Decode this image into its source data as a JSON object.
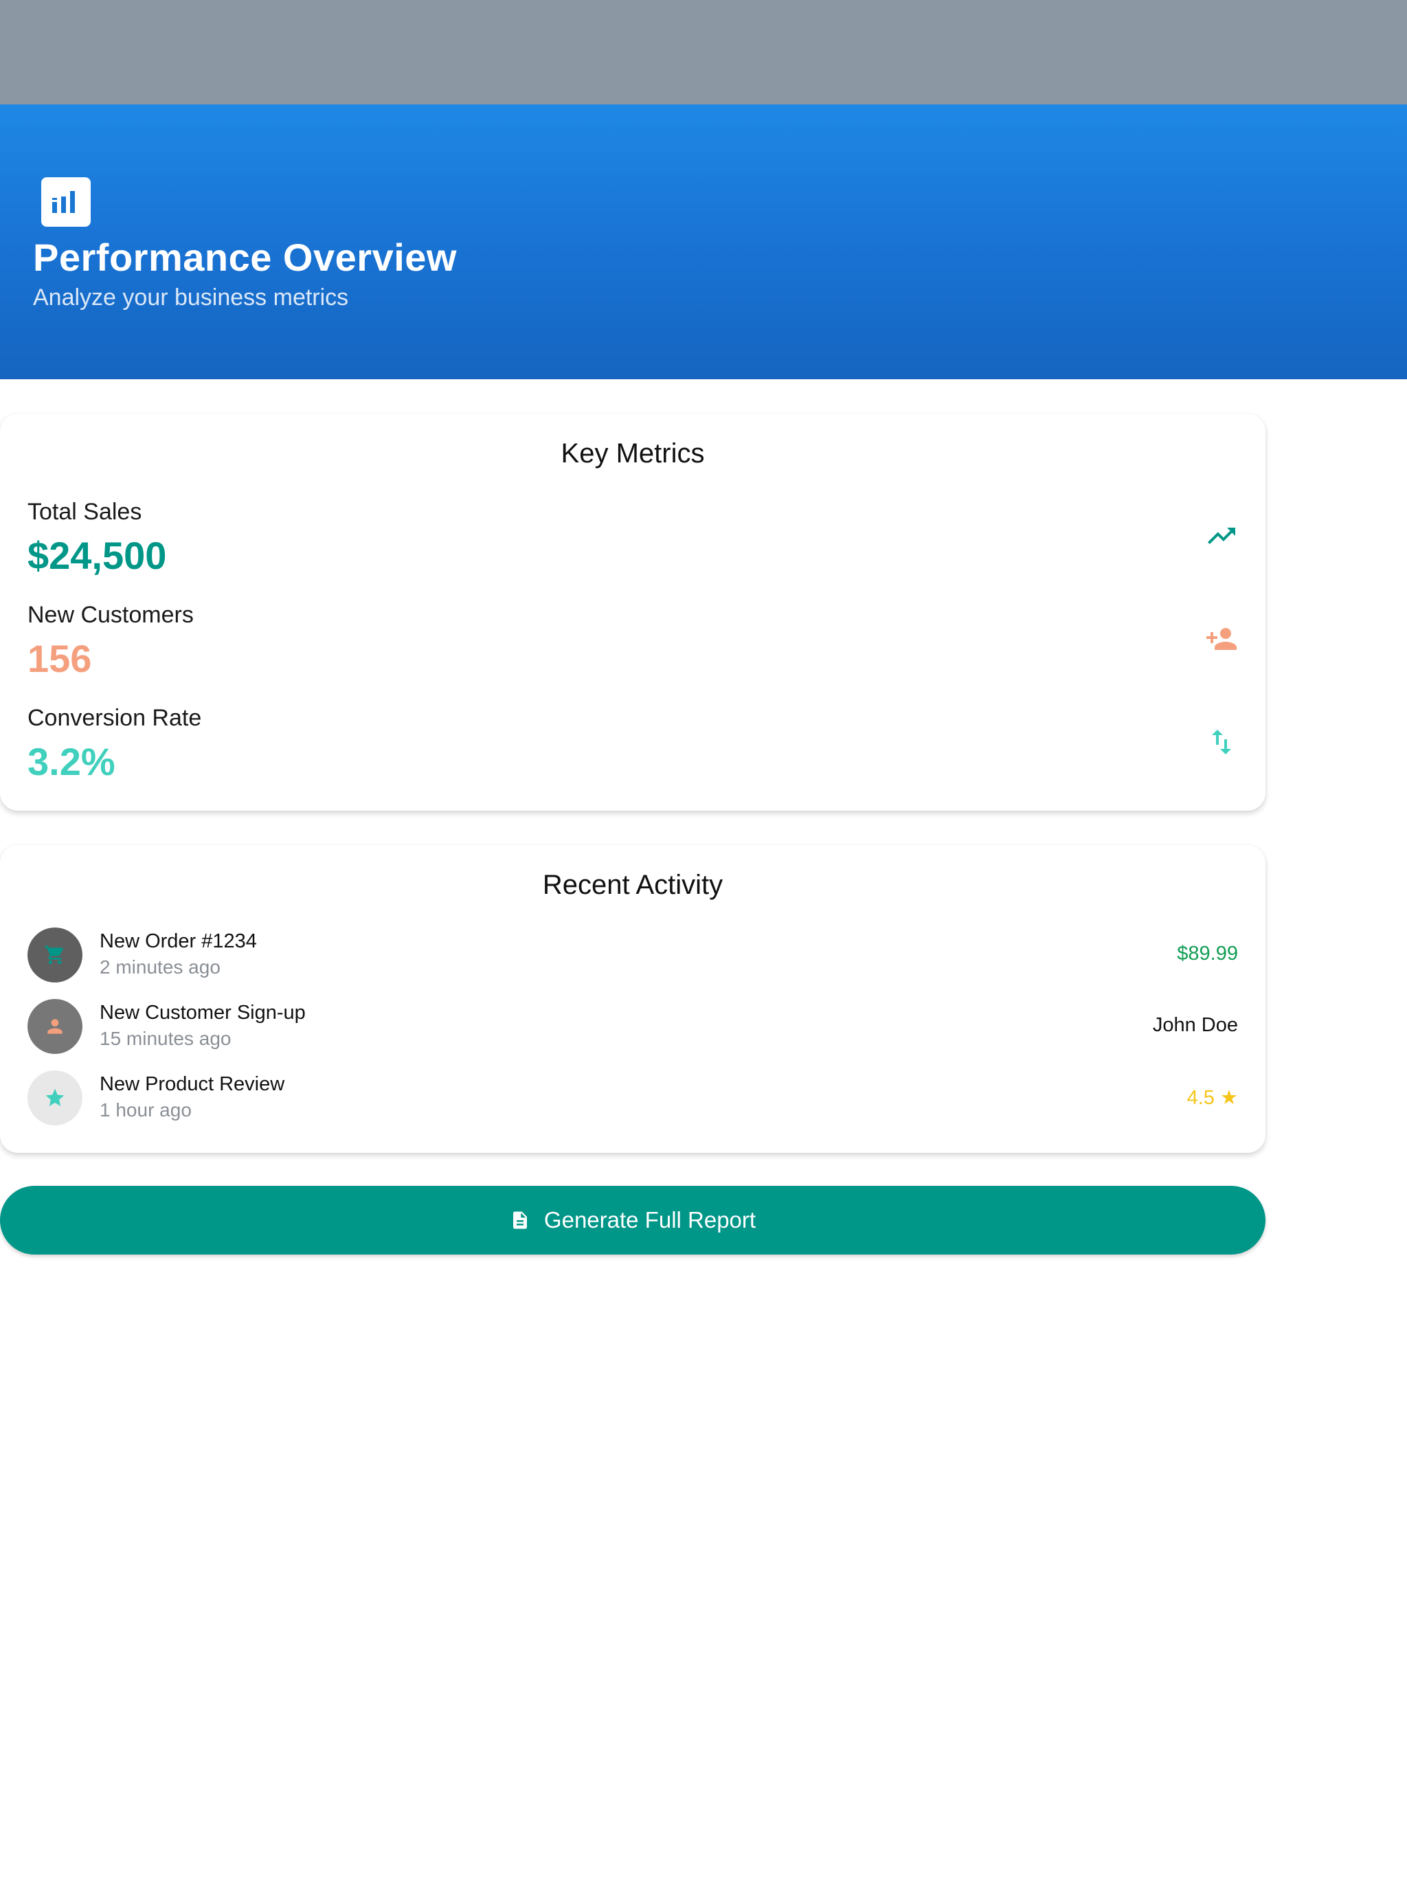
{
  "header": {
    "icon": "bar-chart-icon",
    "title": "Performance Overview",
    "subtitle": "Analyze your business metrics"
  },
  "metrics": {
    "title": "Key Metrics",
    "items": [
      {
        "label": "Total Sales",
        "value": "$24,500",
        "color": "#009688",
        "icon": "trending-up-icon",
        "icon_color": "#009688"
      },
      {
        "label": "New Customers",
        "value": "156",
        "color": "#f4a07f",
        "icon": "person-add-icon",
        "icon_color": "#f4a07f"
      },
      {
        "label": "Conversion Rate",
        "value": "3.2%",
        "color": "#40d0bd",
        "icon": "swap-vert-icon",
        "icon_color": "#40d0bd"
      }
    ]
  },
  "activity": {
    "title": "Recent Activity",
    "items": [
      {
        "title": "New Order #1234",
        "time": "2 minutes ago",
        "value": "$89.99",
        "value_color": "#139e55",
        "icon": "shopping-cart-icon",
        "avatar_bg": "#5f5f5f",
        "icon_color": "#009688"
      },
      {
        "title": "New Customer Sign-up",
        "time": "15 minutes ago",
        "value": "John Doe",
        "value_color": "#111111",
        "icon": "person-icon",
        "avatar_bg": "#777777",
        "icon_color": "#f4a07f"
      },
      {
        "title": "New Product Review",
        "time": "1 hour ago",
        "value": "4.5 ★",
        "value_color": "#f5c51a",
        "icon": "star-icon",
        "avatar_bg": "#e8e8e8",
        "icon_color": "#40d0bd"
      }
    ]
  },
  "actions": {
    "report_label": "Generate Full Report",
    "report_icon": "description-icon"
  },
  "colors": {
    "status_bar": "#8b97a2",
    "header_top": "#1e88e5",
    "header_bottom": "#1565c0",
    "primary_button": "#009688"
  }
}
